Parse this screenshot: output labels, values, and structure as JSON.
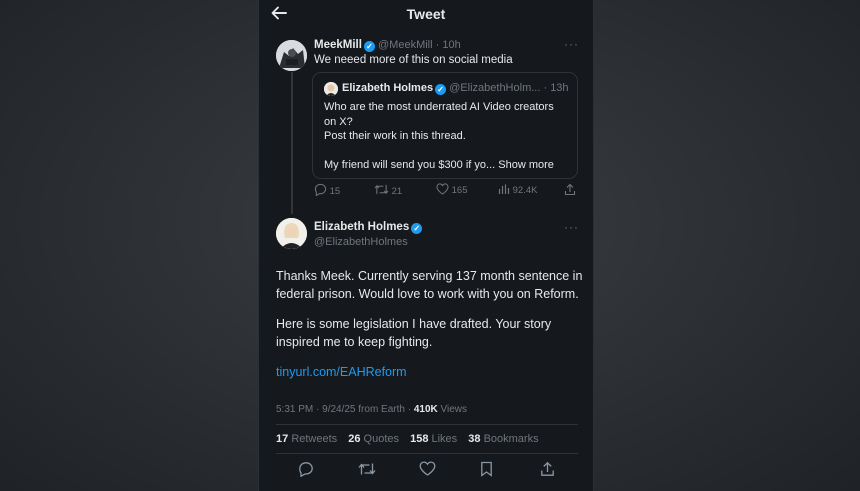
{
  "header": {
    "title": "Tweet",
    "back_icon": "arrow-left-icon"
  },
  "parent_tweet": {
    "name": "MeekMill",
    "handle": "@MeekMill",
    "time": "· 10h",
    "text": "We neeed more of this on social media",
    "quote": {
      "name": "Elizabeth Holmes",
      "handle": "@ElizabethHolm...",
      "time": "· 13h",
      "line1": "Who are the most underrated AI Video creators",
      "line2": "on X?",
      "line3": "Post their work in this thread.",
      "line4": "My friend will send you $300 if yo...",
      "show_more": "Show more"
    },
    "actions": {
      "replies": "15",
      "retweets": "21",
      "likes": "165",
      "views": "92.4K"
    }
  },
  "main_tweet": {
    "name": "Elizabeth Holmes",
    "handle": "@ElizabethHolmes",
    "para1": "Thanks Meek. Currently serving 137 month sentence in federal prison. Would love to work with you on Reform.",
    "para2": "Here is some legislation I have drafted. Your story inspired me to keep fighting.",
    "link": "tinyurl.com/EAHReform",
    "timestamp": "5:31 PM · 9/24/25 from Earth ·",
    "views_count": "410K",
    "views_label": "Views",
    "stats": {
      "retweets_count": "17",
      "retweets_label": "Retweets",
      "quotes_count": "26",
      "quotes_label": "Quotes",
      "likes_count": "158",
      "likes_label": "Likes",
      "bookmarks_count": "38",
      "bookmarks_label": "Bookmarks"
    }
  },
  "colors": {
    "background": "#15191e",
    "accent": "#1d9bf0",
    "muted": "#71767b",
    "text": "#e7e9ea"
  }
}
